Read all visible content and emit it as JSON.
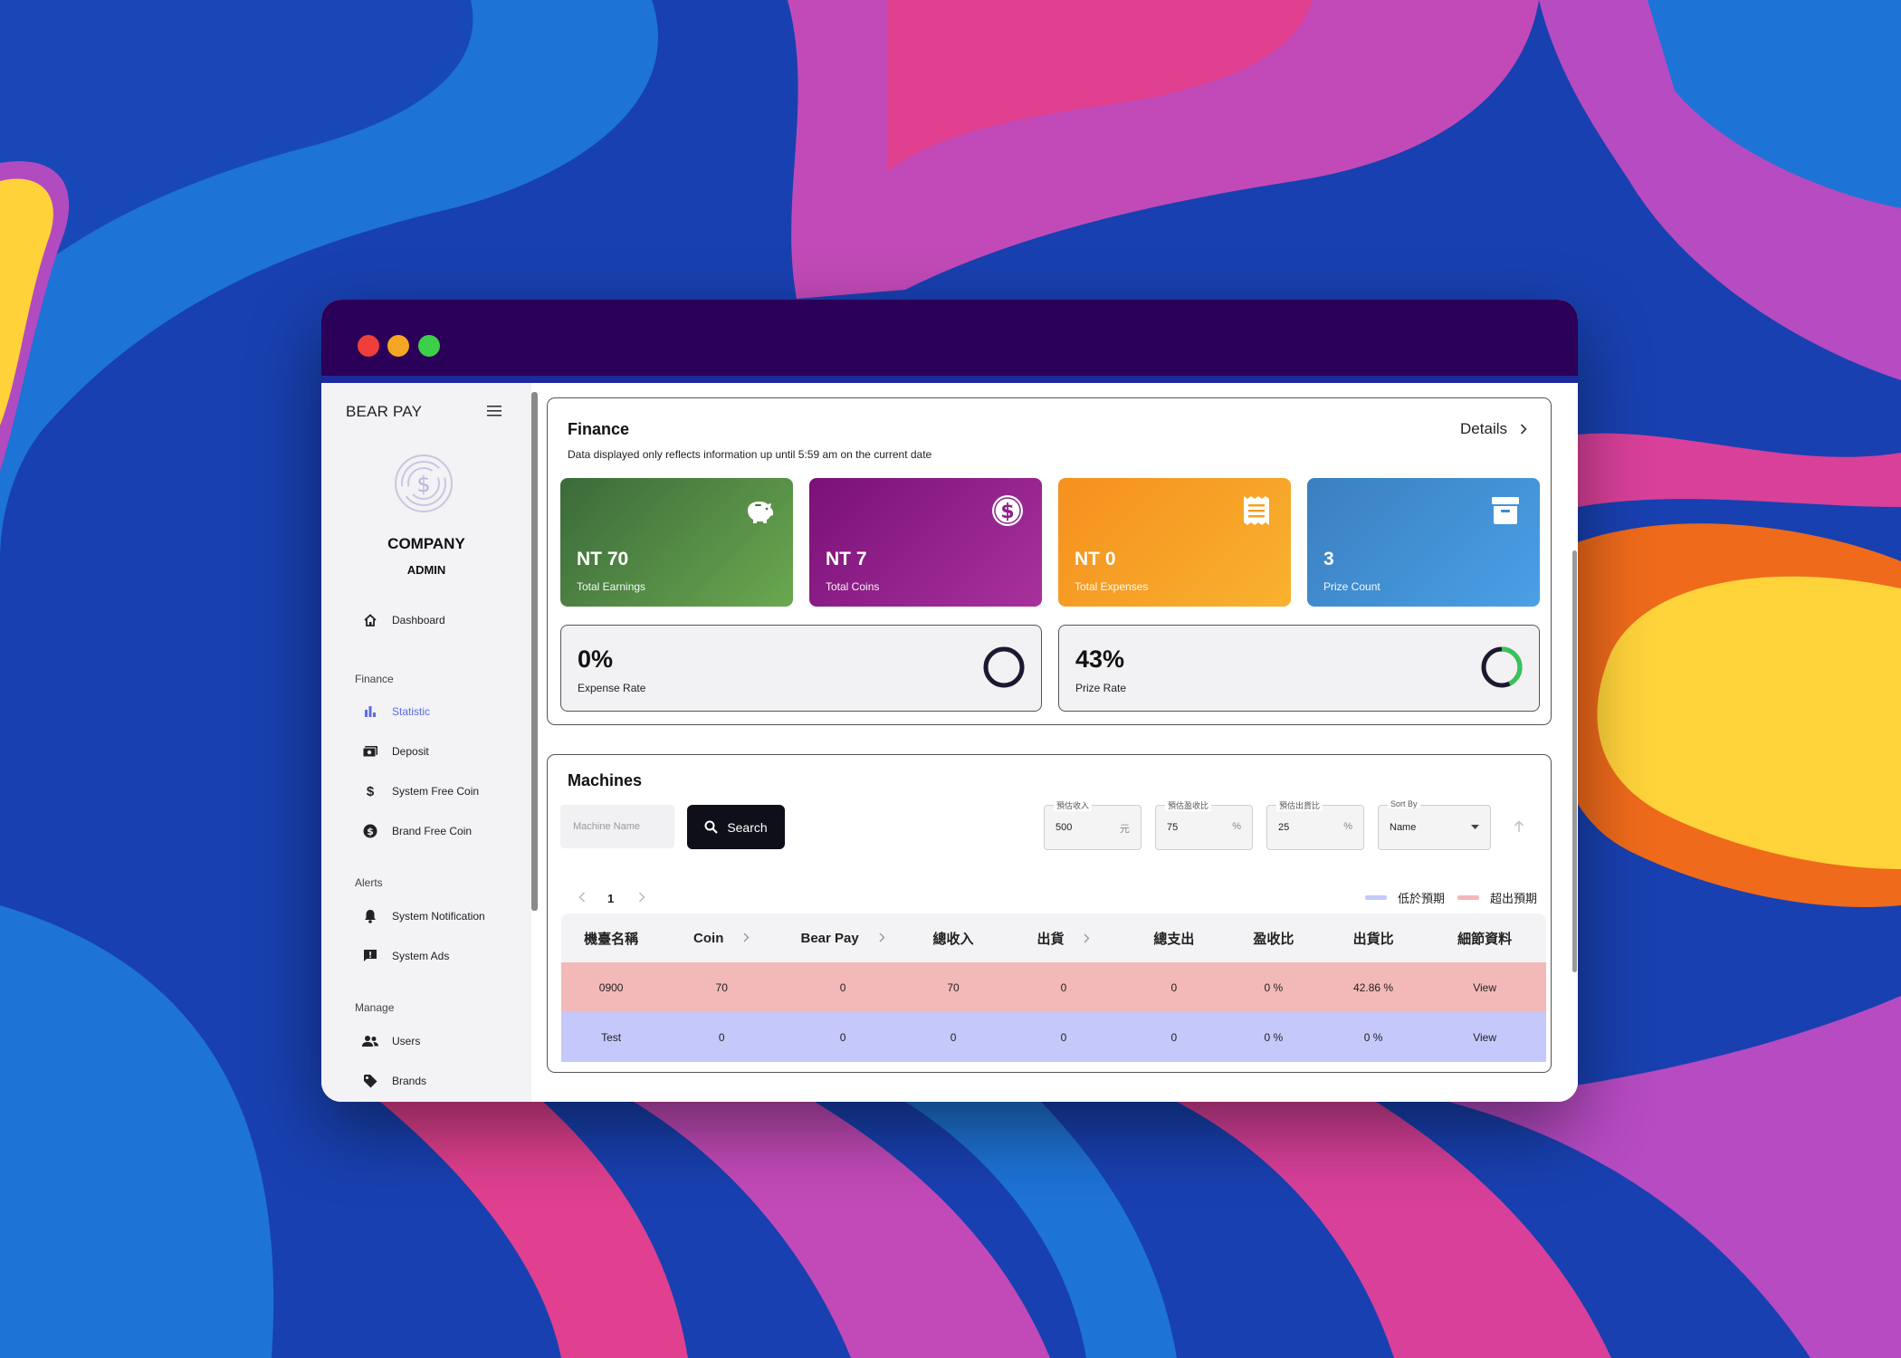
{
  "sidebar": {
    "brand": "BEAR PAY",
    "company": "COMPANY",
    "role": "ADMIN",
    "dashboard": "Dashboard",
    "sections": {
      "finance": "Finance",
      "alerts": "Alerts",
      "manage": "Manage"
    },
    "finance_items": [
      "Statistic",
      "Deposit",
      "System Free Coin",
      "Brand Free Coin"
    ],
    "alerts_items": [
      "System Notification",
      "System Ads"
    ],
    "manage_items": [
      "Users",
      "Brands"
    ],
    "active_color": "#5b6be8"
  },
  "finance": {
    "title": "Finance",
    "subtitle": "Data displayed only reflects information up until 5:59 am on the current date",
    "details": "Details",
    "kpis": [
      {
        "value": "NT 70",
        "label": "Total Earnings",
        "icon": "piggy-bank-icon"
      },
      {
        "value": "NT 7",
        "label": "Total Coins",
        "icon": "dollar-circle-icon"
      },
      {
        "value": "NT 0",
        "label": "Total Expenses",
        "icon": "receipt-icon"
      },
      {
        "value": "3",
        "label": "Prize Count",
        "icon": "archive-box-icon"
      }
    ],
    "rates": [
      {
        "value": "0%",
        "label": "Expense Rate",
        "fraction": 0
      },
      {
        "value": "43%",
        "label": "Prize Rate",
        "fraction": 0.43
      }
    ]
  },
  "machines": {
    "title": "Machines",
    "search_placeholder": "Machine Name",
    "search_button": "Search",
    "filters": [
      {
        "legend": "預估收入",
        "value": "500",
        "unit": "元"
      },
      {
        "legend": "預估盈收比",
        "value": "75",
        "unit": "%"
      },
      {
        "legend": "預估出貨比",
        "value": "25",
        "unit": "%"
      }
    ],
    "sort": {
      "legend": "Sort By",
      "value": "Name"
    },
    "page": "1",
    "legend": {
      "low": "低於預期",
      "high": "超出預期",
      "low_color": "#c5c8fb",
      "high_color": "#f2b9b8"
    },
    "columns": [
      "機臺名稱",
      "Coin",
      "Bear Pay",
      "總收入",
      "出貨",
      "總支出",
      "盈收比",
      "出貨比",
      "細節資料"
    ],
    "rows": [
      {
        "cells": [
          "0900",
          "70",
          "0",
          "70",
          "0",
          "0",
          "0 %",
          "42.86 %",
          "View"
        ],
        "status": "high"
      },
      {
        "cells": [
          "Test",
          "0",
          "0",
          "0",
          "0",
          "0",
          "0 %",
          "0 %",
          "View"
        ],
        "status": "low"
      }
    ]
  }
}
